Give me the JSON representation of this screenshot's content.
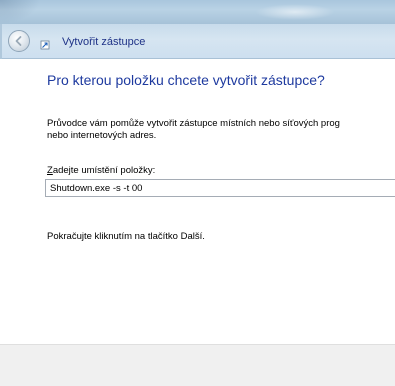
{
  "window": {
    "title": "Vytvořit zástupce"
  },
  "wizard": {
    "heading": "Pro kterou položku chcete vytvořit zástupce?",
    "description_line1": "Průvodce vám pomůže vytvořit zástupce místních nebo síťových prog",
    "description_line2": "nebo internetových adres.",
    "field_label_accesskey": "Z",
    "field_label_rest": "adejte umístění položky:",
    "location_value": "Shutdown.exe -s -t 00",
    "hint": "Pokračujte kliknutím na tlačítko Další."
  },
  "icons": {
    "back": "back-arrow-icon",
    "wizard": "shortcut-wizard-icon"
  }
}
